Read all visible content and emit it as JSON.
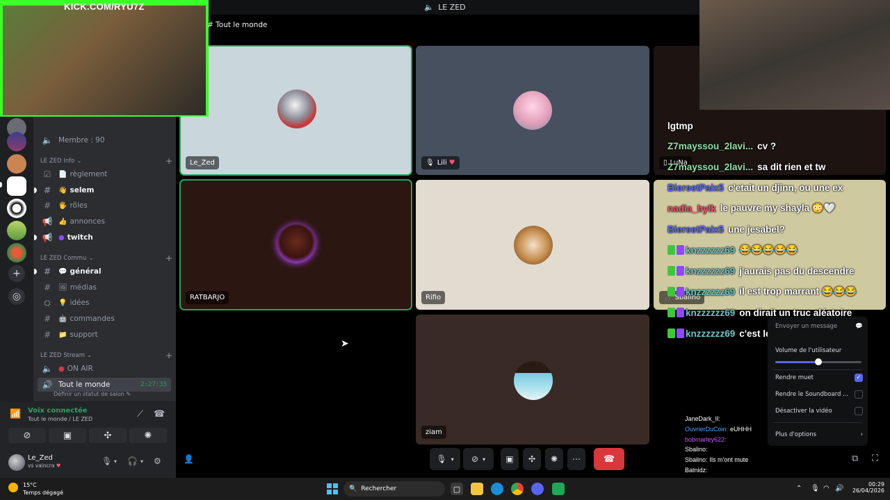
{
  "titlebar": {
    "title": "LE ZED"
  },
  "stage": {
    "header": "Tout le monde"
  },
  "stream_overlay": {
    "kick_url": "KICK.COM/RYU7Z"
  },
  "channels": {
    "member_count": "Membre : 90",
    "categories": [
      {
        "label": "LE ZED Info"
      },
      {
        "label": "LE ZED Commu"
      },
      {
        "label": "LE ZED Stream"
      }
    ],
    "items": [
      {
        "label": "règlement"
      },
      {
        "label": "selem"
      },
      {
        "label": "rôles"
      },
      {
        "label": "annonces"
      },
      {
        "label": "twitch"
      },
      {
        "label": "général"
      },
      {
        "label": "médias"
      },
      {
        "label": "idées"
      },
      {
        "label": "commandes"
      },
      {
        "label": "support"
      },
      {
        "label": "ON AIR"
      },
      {
        "label": "Tout le monde",
        "timer": "2:27:35"
      }
    ],
    "status_prompt": "Définir un statut de salon"
  },
  "voice": {
    "title": "Voix connectée",
    "subtitle": "Tout le monde / LE ZED"
  },
  "user": {
    "name": "Le_Zed",
    "status": "vs vaincra"
  },
  "tiles": [
    {
      "name": "Le_Zed",
      "bg": "#c9d6dc"
    },
    {
      "name": "Lili",
      "bg": "#46505e"
    },
    {
      "name": "LuNa",
      "bg": "#1d1412"
    },
    {
      "name": "RATBARJO",
      "bg": "#2b1611"
    },
    {
      "name": "Rifio",
      "bg": "#e2dcd0"
    },
    {
      "name": "Sbalino",
      "bg": "#cfc9a0"
    },
    {
      "name": "ziam",
      "bg": "#3a2a26"
    }
  ],
  "chat": [
    {
      "user": "",
      "msg": "lgtmp",
      "color": "#8fe0a5"
    },
    {
      "user": "Z7mayssou_2lavi...",
      "msg": "cv ?",
      "color": "#8fe0a5"
    },
    {
      "user": "Z7mayssou_2lavi...",
      "msg": "sa dit rien et tw",
      "color": "#8fe0a5"
    },
    {
      "user": "BiereetPaix5",
      "msg": "c'etait un djinn, ou une ex",
      "color": "#5b6cff"
    },
    {
      "user": "nadia_bylk",
      "msg": "le pauvre my shayla 😳🤍",
      "color": "#ff4f6b"
    },
    {
      "user": "BiereetPaix5",
      "msg": "une jesabel?",
      "color": "#5b6cff"
    },
    {
      "user": "knzzzzzz69",
      "msg": "😂😂😂😂😂",
      "color": "#68c7c7"
    },
    {
      "user": "knzzzzzz69",
      "msg": "j'aurais pas du descendre",
      "color": "#68c7c7"
    },
    {
      "user": "knzzzzzz69",
      "msg": "il est trop marrant 😂😂😂",
      "color": "#68c7c7"
    },
    {
      "user": "knzzzzzz69",
      "msg": "on dirait un truc aléatoire",
      "color": "#68c7c7"
    },
    {
      "user": "knzzzzzz69",
      "msg": "c'est le festival",
      "color": "#68c7c7"
    }
  ],
  "mini_chat": [
    {
      "user": "JaneDark_II:",
      "color": "#ffffff"
    },
    {
      "user": "OuvrierDuCoin:",
      "msg": "eUHHH",
      "color": "#4aa8ff"
    },
    {
      "user": "bobmarley622:",
      "color": "#c45cff"
    },
    {
      "user": "Sbalino:",
      "color": "#ffffff"
    },
    {
      "user": "Sbalino:",
      "msg": "Ils m'ont mute",
      "color": "#ffffff"
    },
    {
      "user": "Batnidz:",
      "color": "#ffffff"
    },
    {
      "user": "Sbalino:",
      "color": "#ffffff"
    },
    {
      "user": "JaneDark_II:",
      "color": "#ffffff"
    }
  ],
  "context_menu": {
    "send_message": "Envoyer un message",
    "volume_label": "Volume de l'utilisateur",
    "volume_percent": 50,
    "mute": "Rendre muet",
    "mute_checked": true,
    "mute_soundboard": "Rendre le Soundboard ...",
    "disable_video": "Désactiver la vidéo",
    "more_options": "Plus d'options"
  },
  "taskbar": {
    "weather_temp": "15°C",
    "weather_desc": "Temps dégagé",
    "search_placeholder": "Rechercher",
    "time": "00:29",
    "date": "26/04/2026"
  }
}
